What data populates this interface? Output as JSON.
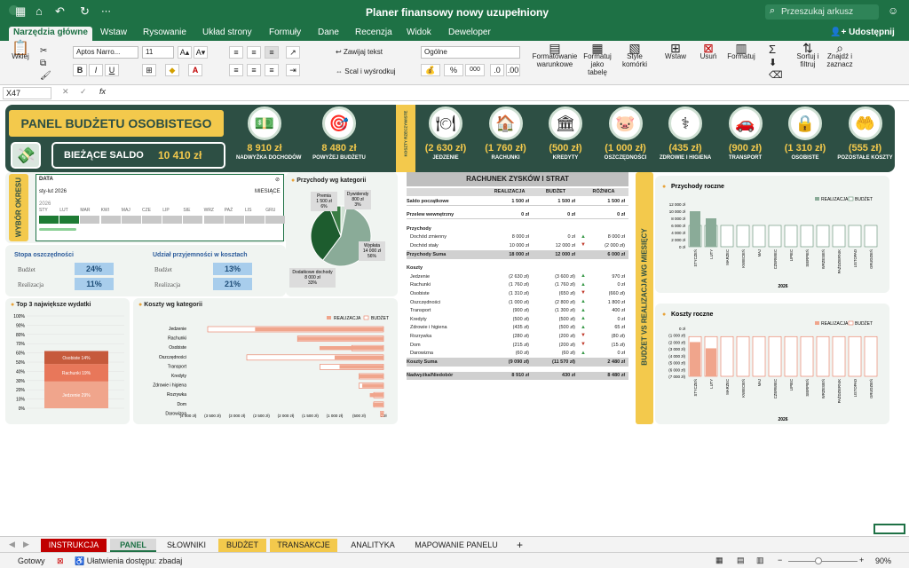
{
  "window": {
    "title": "Planer finansowy nowy uzupełniony",
    "search_placeholder": "Przeszukaj arkusz"
  },
  "ribbon": {
    "tabs": [
      "Narzędzia główne",
      "Wstaw",
      "Rysowanie",
      "Układ strony",
      "Formuły",
      "Dane",
      "Recenzja",
      "Widok",
      "Deweloper"
    ],
    "share": "Udostępnij",
    "paste": "Wklej",
    "font": "Aptos Narro...",
    "font_size": "11",
    "bold": "B",
    "italic": "I",
    "underline": "U",
    "wrap": "Zawijaj tekst",
    "merge": "Scal i wyśrodkuj",
    "number_format": "Ogólne",
    "cond_format": "Formatowanie warunkowe",
    "format_table": "Formatuj jako tabelę",
    "cell_styles": "Style komórki",
    "insert": "Wstaw",
    "delete": "Usuń",
    "format": "Formatuj",
    "sort": "Sortuj i filtruj",
    "find": "Znajdź i zaznacz"
  },
  "formula": {
    "cell_ref": "X47",
    "fx": "fx",
    "content": ""
  },
  "dashboard": {
    "title": "PANEL BUDŻETU OSOBISTEGO",
    "balance_label": "BIEŻĄCE SALDO",
    "balance_value": "10 410 zł",
    "vertical_label": "KOSZTY RZECZYWISTE",
    "kpis_left": [
      {
        "icon": "money",
        "value": "8 910 zł",
        "label": "NADWYŻKA DOCHODÓW"
      },
      {
        "icon": "target",
        "value": "8 480 zł",
        "label": "POWYŻEJ BUDŻETU"
      }
    ],
    "kpis_right": [
      {
        "icon": "food",
        "value": "(2 630 zł)",
        "label": "JEDZENIE"
      },
      {
        "icon": "house",
        "value": "(1 760 zł)",
        "label": "RACHUNKI"
      },
      {
        "icon": "bank",
        "value": "(500 zł)",
        "label": "KREDYTY"
      },
      {
        "icon": "piggy",
        "value": "(1 000 zł)",
        "label": "OSZCZĘDNOŚCI"
      },
      {
        "icon": "doctor",
        "value": "(435 zł)",
        "label": "ZDROWIE I HIGIENA"
      },
      {
        "icon": "car",
        "value": "(900 zł)",
        "label": "TRANSPORT"
      },
      {
        "icon": "lock",
        "value": "(1 310 zł)",
        "label": "OSOBISTE"
      },
      {
        "icon": "hand",
        "value": "(555 zł)",
        "label": "POZOSTAŁE KOSZTY"
      }
    ]
  },
  "period": {
    "side_label": "WYBÓR OKRESU",
    "data_label": "DATA",
    "range": "sty-lut 2026",
    "unit": "MIESIĄCE",
    "year": "2026",
    "months": [
      "STY",
      "LUT",
      "MAR",
      "KWI",
      "MAJ",
      "CZE",
      "LIP",
      "SIE",
      "WRZ",
      "PAŹ",
      "LIS",
      "GRU"
    ],
    "selected": 2
  },
  "rates": {
    "saving_title": "Stopa oszczędności",
    "share_title": "Udział przyjemności w kosztach",
    "budget_label": "Budżet",
    "actual_label": "Realizacja",
    "saving_budget": "24%",
    "saving_actual": "11%",
    "share_budget": "13%",
    "share_actual": "21%"
  },
  "pie": {
    "title": "Przychody wg kategorii",
    "slices": [
      {
        "name": "Wypłata",
        "amount": "14 000 zł",
        "pct": "56%",
        "value": 56,
        "color": "#8aab98"
      },
      {
        "name": "Dodatkowe dochody",
        "amount": "8 000 zł",
        "pct": "33%",
        "value": 33,
        "color": "#1d5c2e"
      },
      {
        "name": "Premia",
        "amount": "1 500 zł",
        "pct": "6%",
        "value": 6,
        "color": "#3a7d44"
      },
      {
        "name": "Dywidendy",
        "amount": "800 zł",
        "pct": "3%",
        "value": 3,
        "color": "#cfe0d3"
      }
    ]
  },
  "top3": {
    "title": "Top 3 największe wydatki",
    "yticks": [
      "100%",
      "90%",
      "80%",
      "70%",
      "60%",
      "50%",
      "40%",
      "30%",
      "20%",
      "10%",
      "0%"
    ],
    "segments": [
      {
        "label": "Jedzenie 29%",
        "value": 29,
        "color": "#f0a58c"
      },
      {
        "label": "Rachunki 19%",
        "value": 19,
        "color": "#e8775a"
      },
      {
        "label": "Osobiste 14%",
        "value": 14,
        "color": "#c65a3c"
      }
    ]
  },
  "costs_cat": {
    "title": "Koszty wg kategorii",
    "legend": [
      "REALIZACJA",
      "BUDŻET"
    ],
    "cats": [
      "Jedzenie",
      "Rachunki",
      "Osobiste",
      "Oszczędności",
      "Transport",
      "Kredyty",
      "Zdrowie i higiena",
      "Rozrywka",
      "Dom",
      "Darowizna"
    ],
    "actual": [
      2630,
      1760,
      1310,
      1000,
      900,
      500,
      435,
      280,
      215,
      60
    ],
    "budget": [
      3600,
      1760,
      650,
      2800,
      1300,
      500,
      500,
      200,
      200,
      60
    ],
    "xticks": [
      "(4 000 zł)",
      "(3 500 zł)",
      "(3 000 zł)",
      "(2 500 zł)",
      "(2 000 zł)",
      "(1 500 zł)",
      "(1 000 zł)",
      "(500 zł)",
      "0 zł"
    ]
  },
  "pnl": {
    "title": "RACHUNEK ZYSKÓW I STRAT",
    "headers": [
      "",
      "REALIZACJA",
      "BUDŻET",
      "RÓŻNICA"
    ],
    "rows": [
      {
        "k": "h",
        "c": [
          "Saldo początkowe",
          "1 500 zł",
          "1 500 zł",
          "1 500 zł"
        ],
        "a": ""
      },
      {
        "k": "sp",
        "c": [
          "",
          "",
          "",
          ""
        ],
        "a": ""
      },
      {
        "k": "h",
        "c": [
          "Przelew wewnętrzny",
          "0 zł",
          "0 zł",
          "0 zł"
        ],
        "a": ""
      },
      {
        "k": "sp",
        "c": [
          "",
          "",
          "",
          ""
        ],
        "a": ""
      },
      {
        "k": "h",
        "c": [
          "Przychody",
          "",
          "",
          ""
        ],
        "a": ""
      },
      {
        "k": "r",
        "c": [
          "Dochód zmienny",
          "8 000 zł",
          "0 zł",
          "8 000 zł"
        ],
        "a": "up"
      },
      {
        "k": "r",
        "c": [
          "Dochód stały",
          "10 000 zł",
          "12 000 zł",
          "(2 000 zł)"
        ],
        "a": "down"
      },
      {
        "k": "s",
        "c": [
          "Przychody Suma",
          "18 000 zł",
          "12 000 zł",
          "6 000 zł"
        ],
        "a": ""
      },
      {
        "k": "sp",
        "c": [
          "",
          "",
          "",
          ""
        ],
        "a": ""
      },
      {
        "k": "h",
        "c": [
          "Koszty",
          "",
          "",
          ""
        ],
        "a": ""
      },
      {
        "k": "r",
        "c": [
          "Jedzenie",
          "(2 630 zł)",
          "(3 600 zł)",
          "970 zł"
        ],
        "a": "up"
      },
      {
        "k": "r",
        "c": [
          "Rachunki",
          "(1 760 zł)",
          "(1 760 zł)",
          "0 zł"
        ],
        "a": "up"
      },
      {
        "k": "r",
        "c": [
          "Osobiste",
          "(1 310 zł)",
          "(650 zł)",
          "(660 zł)"
        ],
        "a": "down"
      },
      {
        "k": "r",
        "c": [
          "Oszczędności",
          "(1 000 zł)",
          "(2 800 zł)",
          "1 800 zł"
        ],
        "a": "up"
      },
      {
        "k": "r",
        "c": [
          "Transport",
          "(900 zł)",
          "(1 300 zł)",
          "400 zł"
        ],
        "a": "up"
      },
      {
        "k": "r",
        "c": [
          "Kredyty",
          "(500 zł)",
          "(500 zł)",
          "0 zł"
        ],
        "a": "up"
      },
      {
        "k": "r",
        "c": [
          "Zdrowie i higiena",
          "(435 zł)",
          "(500 zł)",
          "65 zł"
        ],
        "a": "up"
      },
      {
        "k": "r",
        "c": [
          "Rozrywka",
          "(280 zł)",
          "(200 zł)",
          "(80 zł)"
        ],
        "a": "down"
      },
      {
        "k": "r",
        "c": [
          "Dom",
          "(215 zł)",
          "(200 zł)",
          "(15 zł)"
        ],
        "a": "down"
      },
      {
        "k": "r",
        "c": [
          "Darowizna",
          "(60 zł)",
          "(60 zł)",
          "0 zł"
        ],
        "a": "up"
      },
      {
        "k": "s",
        "c": [
          "Koszty Suma",
          "(9 090 zł)",
          "(11 570 zł)",
          "2 480 zł"
        ],
        "a": ""
      },
      {
        "k": "sp",
        "c": [
          "",
          "",
          "",
          ""
        ],
        "a": ""
      },
      {
        "k": "s",
        "c": [
          "Nadwyżka/Niedobór",
          "8 910 zł",
          "430 zł",
          "8 480 zł"
        ],
        "a": ""
      }
    ]
  },
  "yearly": {
    "side_label": "BUDŻET VS REALIZACJA WG MIESIĘCY",
    "legend": [
      "REALIZACJA",
      "BUDŻET"
    ],
    "months": [
      "STYCZEŃ",
      "LUTY",
      "MARZEC",
      "KWIECIEŃ",
      "MAJ",
      "CZERWIEC",
      "LIPIEC",
      "SIERPIEŃ",
      "WRZESIEŃ",
      "PAŹDZIERNIK",
      "LISTOPAD",
      "GRUDZIEŃ"
    ],
    "year": "2026"
  },
  "chart_data": [
    {
      "type": "bar",
      "title": "Przychody roczne",
      "categories": [
        "STYCZEŃ",
        "LUTY",
        "MARZEC",
        "KWIECIEŃ",
        "MAJ",
        "CZERWIEC",
        "LIPIEC",
        "SIERPIEŃ",
        "WRZESIEŃ",
        "PAŹDZIERNIK",
        "LISTOPAD",
        "GRUDZIEŃ"
      ],
      "series": [
        {
          "name": "REALIZACJA",
          "values": [
            10000,
            8000,
            0,
            0,
            0,
            0,
            0,
            0,
            0,
            0,
            0,
            0
          ]
        },
        {
          "name": "BUDŻET",
          "values": [
            6000,
            6000,
            6000,
            6000,
            6000,
            6000,
            6000,
            6000,
            6000,
            6000,
            6000,
            6000
          ]
        }
      ],
      "ylim": [
        0,
        12000
      ],
      "yticks": [
        "0 zł",
        "2 000 zł",
        "4 000 zł",
        "6 000 zł",
        "8 000 zł",
        "10 000 zł",
        "12 000 zł"
      ],
      "xlabel": "2026"
    },
    {
      "type": "bar",
      "title": "Koszty roczne",
      "categories": [
        "STYCZEŃ",
        "LUTY",
        "MARZEC",
        "KWIECIEŃ",
        "MAJ",
        "CZERWIEC",
        "LIPIEC",
        "SIERPIEŃ",
        "WRZESIEŃ",
        "PAŹDZIERNIK",
        "LISTOPAD",
        "GRUDZIEŃ"
      ],
      "series": [
        {
          "name": "REALIZACJA",
          "values": [
            -5000,
            -4090,
            0,
            0,
            0,
            0,
            0,
            0,
            0,
            0,
            0,
            0
          ]
        },
        {
          "name": "BUDŻET",
          "values": [
            -5800,
            -5800,
            -5800,
            -5800,
            -5800,
            -5800,
            -5800,
            -5800,
            -5800,
            -5800,
            -5800,
            -5800
          ]
        }
      ],
      "ylim": [
        -7000,
        0
      ],
      "yticks": [
        "(7 000 zł)",
        "(6 000 zł)",
        "(5 000 zł)",
        "(4 000 zł)",
        "(3 000 zł)",
        "(2 000 zł)",
        "(1 000 zł)",
        "0 zł"
      ],
      "xlabel": "2026"
    }
  ],
  "sheets": {
    "tabs": [
      {
        "label": "INSTRUKCJA",
        "bg": "#c00000",
        "fg": "#ffffff"
      },
      {
        "label": "PANEL",
        "bg": "#d9d9d9",
        "fg": "#1e7145"
      },
      {
        "label": "SŁOWNIKI",
        "bg": "#f3f3f3",
        "fg": "#222222"
      },
      {
        "label": "BUDŻET",
        "bg": "#f3c94c",
        "fg": "#222222"
      },
      {
        "label": "TRANSAKCJE",
        "bg": "#f3c94c",
        "fg": "#222222"
      },
      {
        "label": "ANALITYKA",
        "bg": "#f3f3f3",
        "fg": "#222222"
      },
      {
        "label": "MAPOWANIE PANELU",
        "bg": "#f3f3f3",
        "fg": "#222222"
      }
    ],
    "add": "+"
  },
  "status": {
    "ready": "Gotowy",
    "accessibility": "Ułatwienia dostępu: zbadaj",
    "zoom": "90%"
  }
}
